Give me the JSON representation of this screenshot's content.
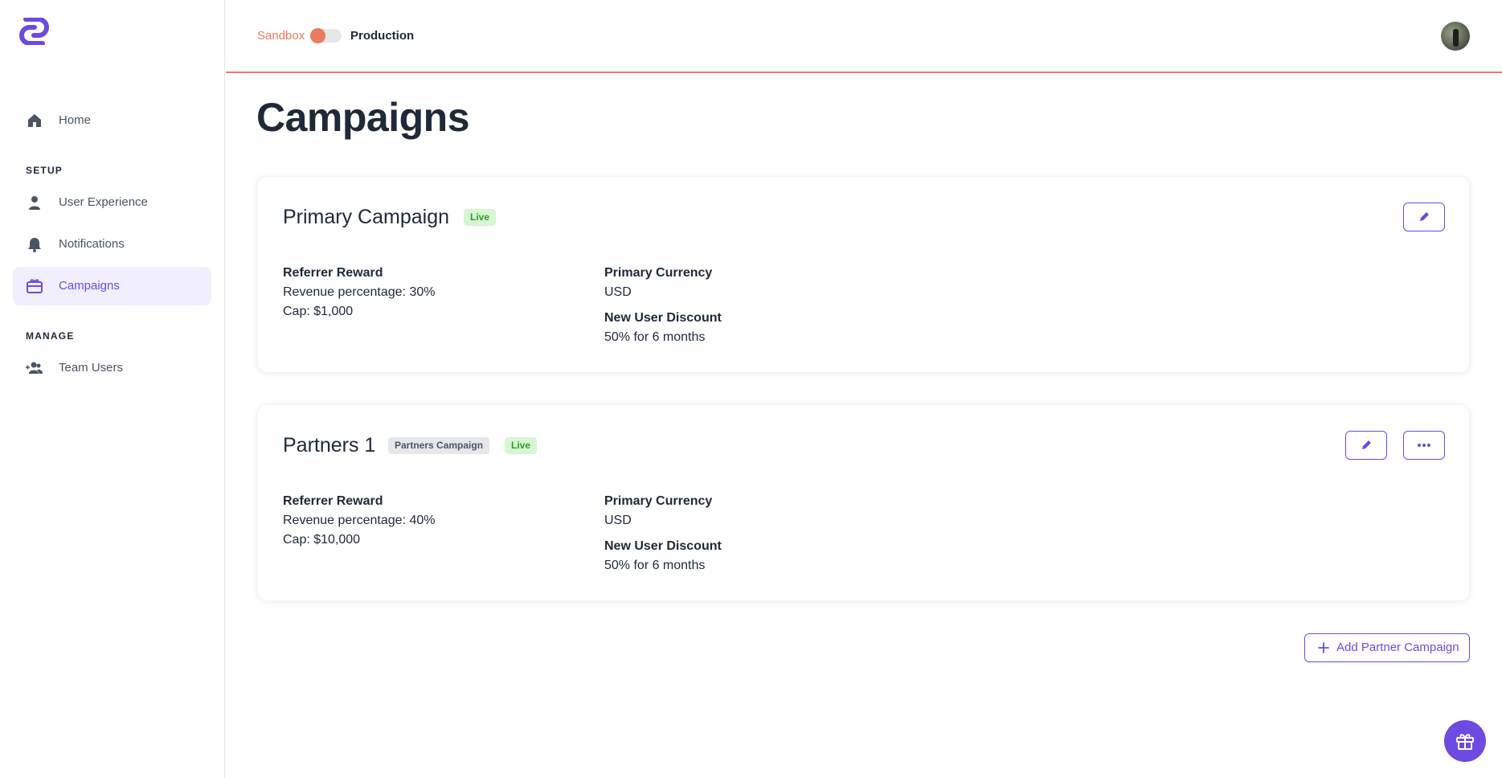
{
  "env": {
    "sandbox": "Sandbox",
    "production": "Production"
  },
  "sidebar": {
    "home": "Home",
    "setup_label": "SETUP",
    "user_experience": "User Experience",
    "notifications": "Notifications",
    "campaigns": "Campaigns",
    "manage_label": "MANAGE",
    "team_users": "Team Users"
  },
  "page": {
    "title": "Campaigns"
  },
  "campaigns": [
    {
      "name": "Primary Campaign",
      "status": "Live",
      "reward_heading": "Referrer Reward",
      "reward_line1": "Revenue percentage: 30%",
      "reward_line2": "Cap: $1,000",
      "currency_heading": "Primary Currency",
      "currency": "USD",
      "discount_heading": "New User Discount",
      "discount": "50% for 6 months"
    },
    {
      "name": "Partners 1",
      "type": "Partners Campaign",
      "status": "Live",
      "reward_heading": "Referrer Reward",
      "reward_line1": "Revenue percentage: 40%",
      "reward_line2": "Cap: $10,000",
      "currency_heading": "Primary Currency",
      "currency": "USD",
      "discount_heading": "New User Discount",
      "discount": "50% for 6 months"
    }
  ],
  "actions": {
    "add_partner_campaign": "Add Partner Campaign"
  },
  "colors": {
    "accent": "#6d4ae0",
    "sandbox": "#ec7a5e",
    "live_bg": "#d7f6d3",
    "live_text": "#2f9a2f"
  }
}
